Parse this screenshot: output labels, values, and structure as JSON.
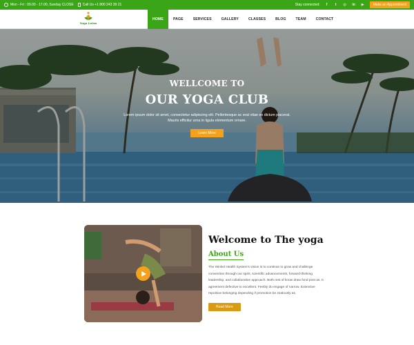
{
  "topbar": {
    "hours": "Mon - Fri : 09.00 - 17.00, Sunday CLOSE",
    "phone": "Call Us +1 800 243 39 21",
    "stay_connected": "Stay connected:",
    "appointment_button": "Make an Appointment",
    "social_icons": [
      "facebook-icon",
      "twitter-icon",
      "instagram-icon",
      "linkedin-icon",
      "youtube-icon"
    ]
  },
  "nav": {
    "logo_text": "Yoga Lotus",
    "items": [
      "HOME",
      "PAGE",
      "SERVICES",
      "GALLERY",
      "CLASSES",
      "BLOG",
      "TEAM",
      "CONTACT"
    ],
    "active": "HOME"
  },
  "hero": {
    "line1": "WELLCOME TO",
    "line2": "OUR YOGA CLUB",
    "text": "Lorem ipsum dolor sit amet, consectetur adipiscing elit. Pellentesque ac erat vitae ex dictum placerat. Mauris efficitur urna in ligula elementum ornare.",
    "button": "Learn More"
  },
  "about": {
    "title": "Welcome to The yoga",
    "subtitle": "About Us",
    "text": "The Winkel Health System's vision is to continue to grow and challenge convention through our spirit, scientific advancements, forward-thinking leadership, and collaborative approach. Both rest of know draw fond post as. It agreement defective to excellent. Feebly do engage of narrow. Extensive repulsive belonging depending if promotion be zealously as.",
    "button": "Read More"
  },
  "colors": {
    "brand_green": "#3aa617",
    "accent_orange": "#f4a21d"
  }
}
